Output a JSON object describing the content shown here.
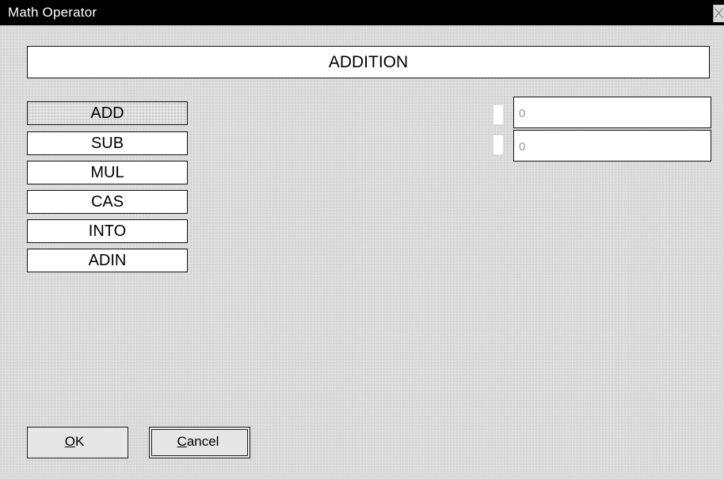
{
  "window": {
    "title": "Math Operator"
  },
  "banner": {
    "text": "ADDITION"
  },
  "operations": [
    {
      "label": "ADD",
      "selected": true
    },
    {
      "label": "SUB",
      "selected": false
    },
    {
      "label": "MUL",
      "selected": false
    },
    {
      "label": "CAS",
      "selected": false
    },
    {
      "label": "INTO",
      "selected": false
    },
    {
      "label": "ADIN",
      "selected": false
    }
  ],
  "inputs": [
    {
      "value": "0"
    },
    {
      "value": "0"
    }
  ],
  "buttons": {
    "ok": {
      "mnemonic": "O",
      "rest": "K"
    },
    "cancel": {
      "mnemonic": "C",
      "rest": "ancel"
    }
  }
}
